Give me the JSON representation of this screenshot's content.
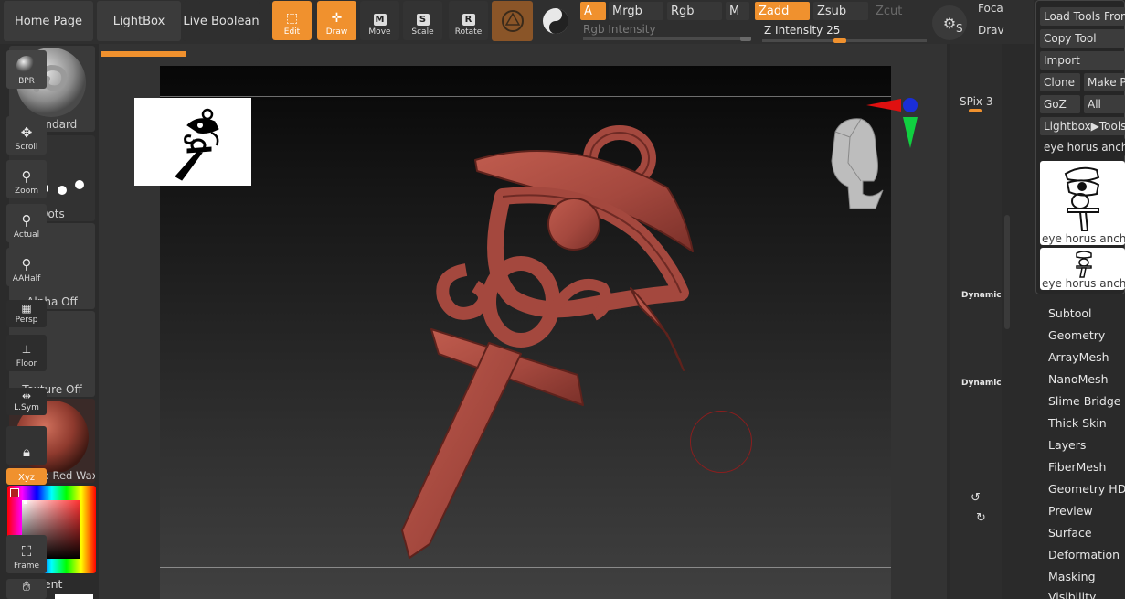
{
  "top": {
    "home_page": "Home Page",
    "lightbox": "LightBox",
    "live_boolean": "Live Boolean",
    "tools": [
      {
        "label": "Edit",
        "icon": "edit-icon",
        "active": true
      },
      {
        "label": "Draw",
        "icon": "draw-icon",
        "active": true
      },
      {
        "label": "Move",
        "icon": "move-icon",
        "letter": "M",
        "active": false
      },
      {
        "label": "Scale",
        "icon": "scale-icon",
        "letter": "S",
        "active": false
      },
      {
        "label": "Rotate",
        "icon": "rotate-icon",
        "letter": "R",
        "active": false
      }
    ],
    "color_a": "A",
    "mrgb": "Mrgb",
    "rgb": "Rgb",
    "m": "M",
    "rgb_intensity": "Rgb Intensity",
    "zadd": "Zadd",
    "zsub": "Zsub",
    "zcut": "Zcut",
    "z_intensity_label": "Z Intensity",
    "z_intensity_value": "25",
    "focal": "Foca",
    "draw_size": "Drav",
    "s_label": "S"
  },
  "left": {
    "brush": "Standard",
    "stroke": "Dots",
    "alpha": "Alpha Off",
    "texture": "Texture Off",
    "material": "MatCap Red Wax",
    "gradient": "Gradient"
  },
  "right_tools": {
    "bpr": "BPR",
    "spix_label": "SPix",
    "spix_value": "3",
    "scroll": "Scroll",
    "zoom": "Zoom",
    "actual": "Actual",
    "aahalf": "AAHalf",
    "dynamic_1": "Dynamic",
    "persp": "Persp",
    "floor": "Floor",
    "dynamic_2": "Dynamic",
    "lsym": "L.Sym",
    "xyz": "Xyz",
    "frame": "Frame"
  },
  "palette": {
    "load_tools": "Load Tools From",
    "copy_tool": "Copy Tool",
    "import": "Import",
    "clone": "Clone",
    "make_p": "Make P",
    "goz": "GoZ",
    "all": "All",
    "lightbox_tools": "Lightbox▶Tools",
    "current_tool": "eye horus anch",
    "thumb1": "eye horus anch c",
    "thumb2": "eye horus anch c",
    "menu": [
      "Subtool",
      "Geometry",
      "ArrayMesh",
      "NanoMesh",
      "Slime Bridge",
      "Thick Skin",
      "Layers",
      "FiberMesh",
      "Geometry HD",
      "Preview",
      "Surface",
      "Deformation",
      "Masking",
      "Visibility"
    ]
  },
  "colors": {
    "accent": "#f0912e",
    "model": "#a4483e",
    "model_dark": "#6e2a24"
  }
}
